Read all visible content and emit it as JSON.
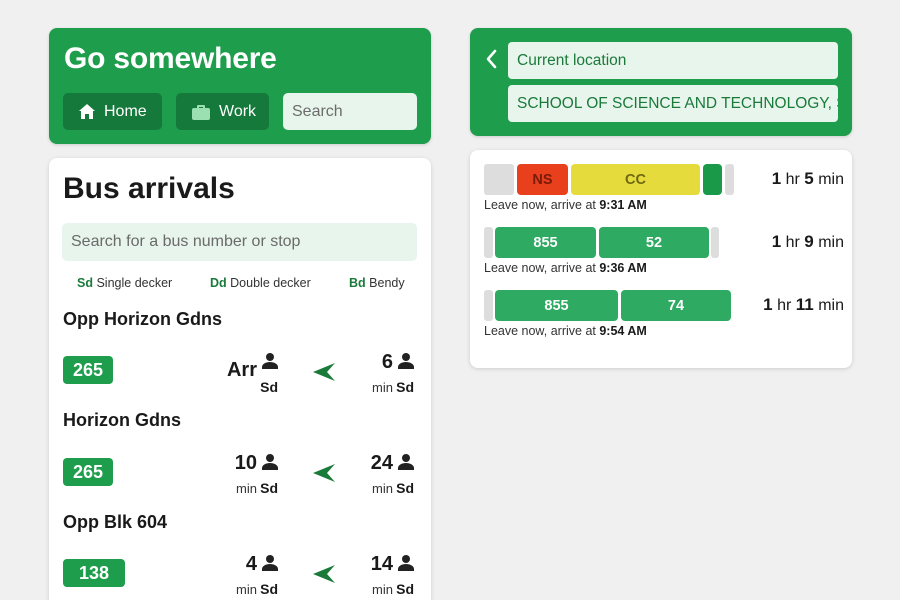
{
  "go": {
    "title": "Go somewhere",
    "home_label": "Home",
    "work_label": "Work",
    "search_placeholder": "Search"
  },
  "bus": {
    "title": "Bus arrivals",
    "search_placeholder": "Search for a bus number or stop",
    "legend": [
      {
        "code": "Sd",
        "label": "Single decker"
      },
      {
        "code": "Dd",
        "label": "Double decker"
      },
      {
        "code": "Bd",
        "label": "Bendy"
      }
    ],
    "stops": [
      {
        "name": "Opp Horizon Gdns",
        "service": "265",
        "next": {
          "value": "Arr",
          "unit": "",
          "deck": "Sd"
        },
        "subsequent": {
          "value": "6",
          "unit": "min",
          "deck": "Sd"
        }
      },
      {
        "name": "Horizon Gdns",
        "service": "265",
        "next": {
          "value": "10",
          "unit": "min",
          "deck": "Sd"
        },
        "subsequent": {
          "value": "24",
          "unit": "min",
          "deck": "Sd"
        }
      },
      {
        "name": "Opp Blk 604",
        "service": "138",
        "next": {
          "value": "4",
          "unit": "min",
          "deck": "Sd"
        },
        "subsequent": {
          "value": "14",
          "unit": "min",
          "deck": "Sd"
        }
      }
    ]
  },
  "route": {
    "from": "Current location",
    "to": "SCHOOL OF SCIENCE AND TECHNOLOGY, SINGAPORE"
  },
  "trips": [
    {
      "segments": [
        {
          "label": "",
          "kind": "walk",
          "color": "#dddddd",
          "text_color": "#333333"
        },
        {
          "label": "NS",
          "kind": "mrt",
          "color": "#e8401c",
          "text_color": "#7a1a08"
        },
        {
          "label": "CC",
          "kind": "mrt",
          "color": "#e6db3c",
          "text_color": "#6e6812"
        },
        {
          "label": "",
          "kind": "bus",
          "color": "#1a9a48",
          "text_color": "#ffffff"
        },
        {
          "label": "",
          "kind": "walk",
          "color": "#dddddd",
          "text_color": "#333333"
        }
      ],
      "hr": "1",
      "hr_unit": "hr",
      "min": "5",
      "min_unit": "min",
      "leave_text": "Leave now, arrive at ",
      "arrive": "9:31 AM"
    },
    {
      "segments": [
        {
          "label": "",
          "kind": "walk",
          "color": "#dddddd",
          "text_color": "#333333"
        },
        {
          "label": "855",
          "kind": "bus",
          "color": "#2eaa62",
          "text_color": "#ffffff"
        },
        {
          "label": "52",
          "kind": "bus",
          "color": "#2eaa62",
          "text_color": "#ffffff"
        },
        {
          "label": "",
          "kind": "walk",
          "color": "#dddddd",
          "text_color": "#333333"
        }
      ],
      "hr": "1",
      "hr_unit": "hr",
      "min": "9",
      "min_unit": "min",
      "leave_text": "Leave now, arrive at ",
      "arrive": "9:36 AM"
    },
    {
      "segments": [
        {
          "label": "",
          "kind": "walk",
          "color": "#dddddd",
          "text_color": "#333333"
        },
        {
          "label": "855",
          "kind": "bus",
          "color": "#2eaa62",
          "text_color": "#ffffff"
        },
        {
          "label": "74",
          "kind": "bus",
          "color": "#2eaa62",
          "text_color": "#ffffff"
        }
      ],
      "hr": "1",
      "hr_unit": "hr",
      "min": "11",
      "min_unit": "min",
      "leave_text": "Leave now, arrive at ",
      "arrive": "9:54 AM"
    }
  ],
  "colors": {
    "brand_green": "#1e9e4c",
    "dark_green": "#14793a",
    "light_green_bg": "#e8f5ec",
    "arrow_green": "#1a7a3a"
  },
  "icons": {
    "home": "home-icon",
    "work": "briefcase-icon",
    "back": "chevron-left-icon",
    "person": "person-icon",
    "direction": "direction-arrow-icon"
  }
}
